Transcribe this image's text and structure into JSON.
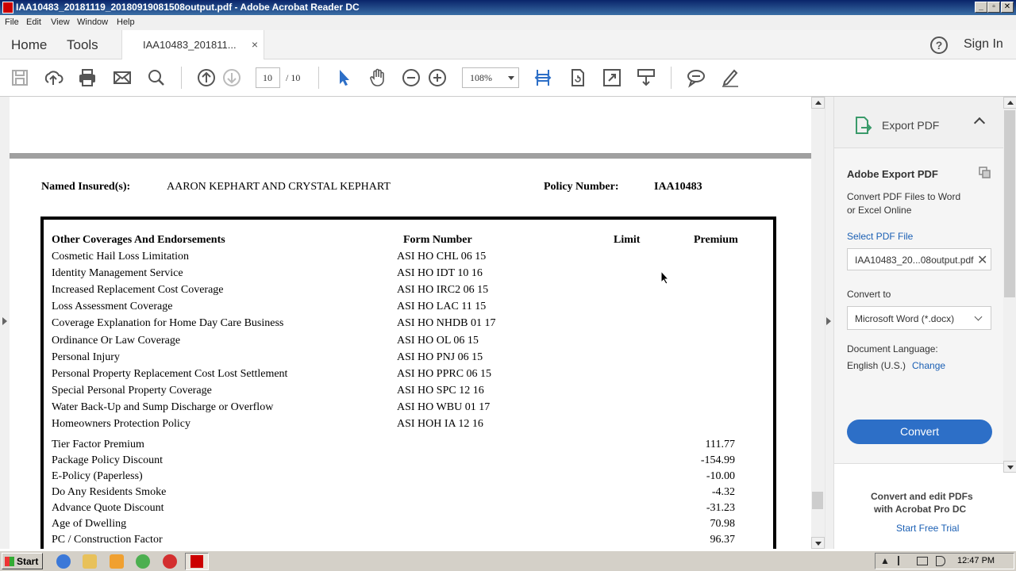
{
  "window": {
    "title": "IAA10483_20181119_20180919081508output.pdf - Adobe Acrobat Reader DC",
    "controls": [
      "_",
      "▫",
      "✕"
    ]
  },
  "menu": [
    "File",
    "Edit",
    "View",
    "Window",
    "Help"
  ],
  "tabs": {
    "home": "Home",
    "tools": "Tools",
    "document": "IAA10483_201811...",
    "close": "×",
    "help": "?",
    "sign_in": "Sign In"
  },
  "toolbar": {
    "page_current": "10",
    "page_total": "/ 10",
    "zoom": "108%",
    "icons": [
      "save-icon",
      "upload-icon",
      "print-icon",
      "email-icon",
      "search-icon",
      "page-up-icon",
      "page-down-icon",
      "select-cursor-icon",
      "hand-icon",
      "zoom-out-icon",
      "zoom-in-icon",
      "fit-width-icon",
      "rotate-icon",
      "fullscreen-icon",
      "scroll-mode-icon",
      "comment-icon",
      "sign-icon"
    ]
  },
  "document": {
    "named_insured_label": "Named Insured(s):",
    "named_insured_value": "AARON  KEPHART AND CRYSTAL  KEPHART",
    "policy_number_label": "Policy Number:",
    "policy_number_value": "IAA10483",
    "columns": {
      "coverages": "Other Coverages And Endorsements",
      "form_number": "Form Number",
      "limit": "Limit",
      "premium": "Premium"
    },
    "endorsements": [
      {
        "name": "Cosmetic Hail Loss Limitation",
        "form": "ASI HO CHL 06 15"
      },
      {
        "name": "Identity Management Service",
        "form": "ASI HO IDT 10 16"
      },
      {
        "name": "Increased Replacement Cost Coverage",
        "form": "ASI HO IRC2 06 15"
      },
      {
        "name": "Loss Assessment Coverage",
        "form": "ASI HO LAC 11 15"
      },
      {
        "name": "Coverage Explanation for Home Day Care Business",
        "form": "ASI HO NHDB 01 17"
      },
      {
        "name": "Ordinance Or Law Coverage",
        "form": "ASI HO OL 06 15"
      },
      {
        "name": "Personal Injury",
        "form": "ASI HO PNJ 06 15"
      },
      {
        "name": "Personal Property Replacement Cost Lost Settlement",
        "form": "ASI HO PPRC 06 15"
      },
      {
        "name": "Special Personal Property Coverage",
        "form": "ASI HO SPC 12 16"
      },
      {
        "name": "Water Back-Up and Sump Discharge or Overflow",
        "form": "ASI HO WBU 01 17"
      },
      {
        "name": "Homeowners Protection Policy",
        "form": "ASI HOH IA 12 16"
      }
    ],
    "factors": [
      {
        "name": "Tier Factor Premium",
        "premium": "111.77"
      },
      {
        "name": "Package Policy Discount",
        "premium": "-154.99"
      },
      {
        "name": "E-Policy (Paperless)",
        "premium": "-10.00"
      },
      {
        "name": "Do Any Residents Smoke",
        "premium": "-4.32"
      },
      {
        "name": "Advance Quote Discount",
        "premium": "-31.23"
      },
      {
        "name": "Age of Dwelling",
        "premium": "70.98"
      },
      {
        "name": "PC / Construction Factor",
        "premium": "96.37"
      }
    ]
  },
  "export_pane": {
    "header": "Export PDF",
    "section_title": "Adobe Export PDF",
    "description_line1": "Convert PDF Files to Word",
    "description_line2": "or Excel Online",
    "select_label": "Select PDF File",
    "selected_file": "IAA10483_20...08output.pdf",
    "convert_to_label": "Convert to",
    "convert_to_value": "Microsoft Word (*.docx)",
    "language_label": "Document Language:",
    "language_value": "English (U.S.)",
    "change_link": "Change",
    "convert_button": "Convert",
    "promo_line1": "Convert and edit PDFs",
    "promo_line2": "with Acrobat Pro DC",
    "trial_link": "Start Free Trial"
  },
  "taskbar": {
    "start": "Start",
    "clock": "12:47 PM"
  },
  "colors": {
    "accent_blue": "#2d6fc7",
    "link_blue": "#1a5fb4",
    "title_bar": "#0a246a"
  }
}
